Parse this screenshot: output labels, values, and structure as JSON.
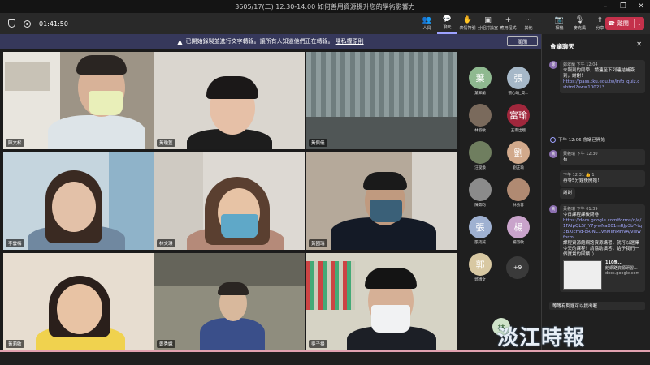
{
  "window": {
    "title": "3605/17(二) 12:30-14:00 如何善用資源提升您的學術影響力"
  },
  "toolbar": {
    "timer": "01:41:50",
    "tools": [
      {
        "label": "人員",
        "icon": "👥",
        "active": false
      },
      {
        "label": "聊天",
        "icon": "💬",
        "active": true
      },
      {
        "label": "表情符號",
        "icon": "✋",
        "active": false
      },
      {
        "label": "分組討論室",
        "icon": "▣",
        "active": false
      },
      {
        "label": "應用程式",
        "icon": "+",
        "active": false
      },
      {
        "label": "其他",
        "icon": "···",
        "active": false
      }
    ],
    "device_tools": [
      {
        "label": "相機",
        "icon": "📷"
      },
      {
        "label": "麥克風",
        "icon": "🎙"
      },
      {
        "label": "分享",
        "icon": "⇧"
      }
    ],
    "leave_label": "離開"
  },
  "banner": {
    "text": "已開始錄製並進行文字轉錄。讓所有人知道他們正在轉錄。",
    "link": "隱私權原則",
    "close_label": "關閉"
  },
  "tiles": [
    {
      "name": "陳文松"
    },
    {
      "name": "黃瓊萱"
    },
    {
      "name": "黃佩儀"
    },
    {
      "name": "李雲梅"
    },
    {
      "name": "林文琪"
    },
    {
      "name": "黃國瑞"
    },
    {
      "name": "黃莉敏"
    },
    {
      "name": "鄭秀娥"
    },
    {
      "name": "吳子揚"
    }
  ],
  "roster": [
    {
      "initial": "葉",
      "label": "葉翠蘭",
      "color": "#8fb990"
    },
    {
      "initial": "張",
      "label": "張心瑜_資...",
      "color": "#a6b8c8"
    },
    {
      "initial": "",
      "label": "林淑敏",
      "color": "#7a6a5c"
    },
    {
      "initial": "富瑜",
      "label": "五南出版",
      "color": "#a0273c"
    },
    {
      "initial": "",
      "label": "汪俊煥",
      "color": "#6f7e5f"
    },
    {
      "initial": "劉",
      "label": "劉芷瑜",
      "color": "#d1a98b"
    },
    {
      "initial": "",
      "label": "陳茹昀",
      "color": "#8b8b8b"
    },
    {
      "initial": "",
      "label": "林秀蓉",
      "color": "#b08a72"
    },
    {
      "initial": "張",
      "label": "張筠誠",
      "color": "#9fb1d1"
    },
    {
      "initial": "楊",
      "label": "楊淑敏",
      "color": "#c9a3cb"
    },
    {
      "initial": "郭",
      "label": "郭博文",
      "color": "#d8c8a2"
    }
  ],
  "roster_more": "+9",
  "self_initial": "林",
  "chat": {
    "title": "會議聊天",
    "messages": [
      {
        "author": "鄭翠蘭",
        "time": "下午 12:04",
        "text": "未報到的同學，請連至下列連結補簽到，謝謝！",
        "link": "https://pass.tku.edu.tw/info_quiz.cshtml?sw=100213"
      },
      {
        "system": "下午 12:06 會議已開始"
      },
      {
        "author": "黃義瑞",
        "time": "下午 12:30",
        "text": "有"
      },
      {
        "time": "下午 12:31",
        "text": "再等5分鐘後開始！",
        "reaction": "👍 1"
      },
      {
        "text": "謝謝"
      },
      {
        "author": "黃義瑞",
        "time": "下午 01:39",
        "text": "今日課程課後問卷：",
        "link": "https://docs.google.com/forms/d/e/1FAIpQLSf_Y7y-wNaX01mRJp3bY-tq3BXIcmd-qR-NC1vhMIlnMHVA/viewform",
        "text2": "課程資源館網路資源講習，就可以選擇今天的課程！請協助填答，給予我們一個寶貴的回饋：）",
        "preview_title": "110學...",
        "preview_sub": "館網路資源研習...",
        "preview_domain": "docs.google.com"
      },
      {
        "text": "等等有問題可以提出喔"
      }
    ]
  },
  "watermark": "淡江時報"
}
